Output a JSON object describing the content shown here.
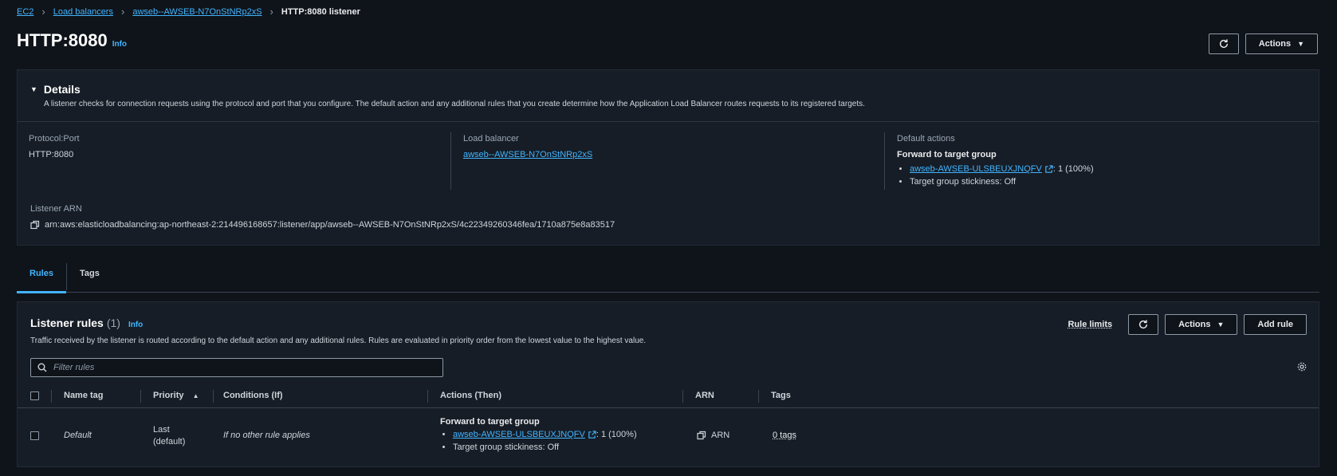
{
  "breadcrumb": {
    "items": [
      "EC2",
      "Load balancers",
      "awseb--AWSEB-N7OnStNRp2xS"
    ],
    "current": "HTTP:8080 listener"
  },
  "header": {
    "title": "HTTP:8080",
    "info": "Info",
    "actions_label": "Actions"
  },
  "details": {
    "title": "Details",
    "description": "A listener checks for connection requests using the protocol and port that you configure. The default action and any additional rules that you create determine how the Application Load Balancer routes requests to its registered targets.",
    "protocol_port_label": "Protocol:Port",
    "protocol_port_value": "HTTP:8080",
    "load_balancer_label": "Load balancer",
    "load_balancer_value": "awseb--AWSEB-N7OnStNRp2xS",
    "default_actions_label": "Default actions",
    "default_actions_heading": "Forward to target group",
    "target_group_link": "awseb-AWSEB-ULSBEUXJNQFV",
    "target_group_weight": ": 1 (100%)",
    "stickiness": "Target group stickiness: Off",
    "listener_arn_label": "Listener ARN",
    "listener_arn_value": "arn:aws:elasticloadbalancing:ap-northeast-2:214496168657:listener/app/awseb--AWSEB-N7OnStNRp2xS/4c22349260346fea/1710a875e8a83517"
  },
  "tabs": [
    {
      "label": "Rules",
      "active": true
    },
    {
      "label": "Tags",
      "active": false
    }
  ],
  "rules": {
    "title": "Listener rules",
    "count": "(1)",
    "info": "Info",
    "description": "Traffic received by the listener is routed according to the default action and any additional rules. Rules are evaluated in priority order from the lowest value to the highest value.",
    "rule_limits": "Rule limits",
    "actions_label": "Actions",
    "add_rule_label": "Add rule",
    "filter_placeholder": "Filter rules",
    "columns": {
      "name_tag": "Name tag",
      "priority": "Priority",
      "conditions": "Conditions (If)",
      "actions": "Actions (Then)",
      "arn": "ARN",
      "tags": "Tags"
    },
    "rows": [
      {
        "name": "Default",
        "priority_line1": "Last",
        "priority_line2": "(default)",
        "conditions": "If no other rule applies",
        "action_heading": "Forward to target group",
        "target_group": "awseb-AWSEB-ULSBEUXJNQFV",
        "weight": ": 1 (100%)",
        "stickiness": "Target group stickiness: Off",
        "arn": "ARN",
        "tags": "0 tags"
      }
    ]
  },
  "colors": {
    "background": "#0f141a",
    "panel": "#161d26",
    "link": "#42b4ff"
  }
}
